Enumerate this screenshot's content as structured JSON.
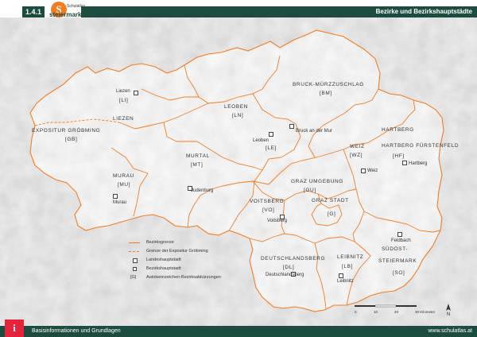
{
  "header": {
    "code": "1.4.1",
    "logo_mark": "S",
    "logo_small": "Schulatlas",
    "logo_big": "steiermark",
    "title": "Bezirke und Bezirkshauptstädte"
  },
  "districts": {
    "liezen": {
      "name": "LIEZEN",
      "abbr": "[LI]"
    },
    "groebming": {
      "name": "EXPOSITUR GRÖBMING",
      "abbr": "[GB]"
    },
    "bruck": {
      "name": "BRUCK-MÜRZZUSCHLAG",
      "abbr": "[BM]"
    },
    "leoben": {
      "name": "LEOBEN",
      "abbr": "[LN]"
    },
    "murtal": {
      "name": "MURTAL",
      "abbr": "[MT]"
    },
    "murau": {
      "name": "MURAU",
      "abbr": "[MU]"
    },
    "weiz": {
      "name": "WEIZ",
      "abbr": "[WZ]"
    },
    "hartberg": {
      "name": "HARTBERG FÜRSTENFELD",
      "abbr": "[HF]"
    },
    "graz_umgebung": {
      "name": "GRAZ UMGEBUNG",
      "abbr": "[GU]"
    },
    "graz_stadt": {
      "name": "GRAZ STADT",
      "abbr": "[G]"
    },
    "voitsberg": {
      "name": "VOITSBERG",
      "abbr": "[VO]"
    },
    "deutschlandsberg": {
      "name": "DEUTSCHLANDSBERG",
      "abbr": "[DL]"
    },
    "leibnitz": {
      "name": "LEIBNITZ",
      "abbr": "[LB]"
    },
    "suedoststeiermark": {
      "name": "SÜDOST-STEIERMARK",
      "abbr": "[SO]"
    }
  },
  "towns": {
    "liezen": "Liezen",
    "leoben": "Leoben",
    "bruck": "Bruck an der Mur",
    "judenburg": "Judenburg",
    "murau": "Murau",
    "weiz": "Weiz",
    "hartberg": "Hartberg",
    "voitsberg": "Voitsberg",
    "deutschlandsberg": "Deutschlandsberg",
    "leibnitz": "Leibnitz",
    "feldbach": "Feldbach"
  },
  "legend": {
    "district_border": "Bezirksgrenze",
    "expositur_border": "Grenze der Expositur Gröbming",
    "state_capital": "Landeshauptstadt",
    "district_capital": "Bezirkshauptstadt",
    "plate_code_symbol": "[G]",
    "plate_codes": "Autokennzeichen-Bezirksabkürzungen"
  },
  "scale": {
    "ticks": [
      "0",
      "10",
      "20",
      "30 Kilometer"
    ],
    "north": "N"
  },
  "footer": {
    "logo_mark": "i",
    "left": "Basisinformationen und Grundlagen",
    "right": "www.schulatlas.at"
  },
  "colors": {
    "header_green": "#1c4b40",
    "border_orange": "#f47c20",
    "footer_red": "#e5243b"
  }
}
